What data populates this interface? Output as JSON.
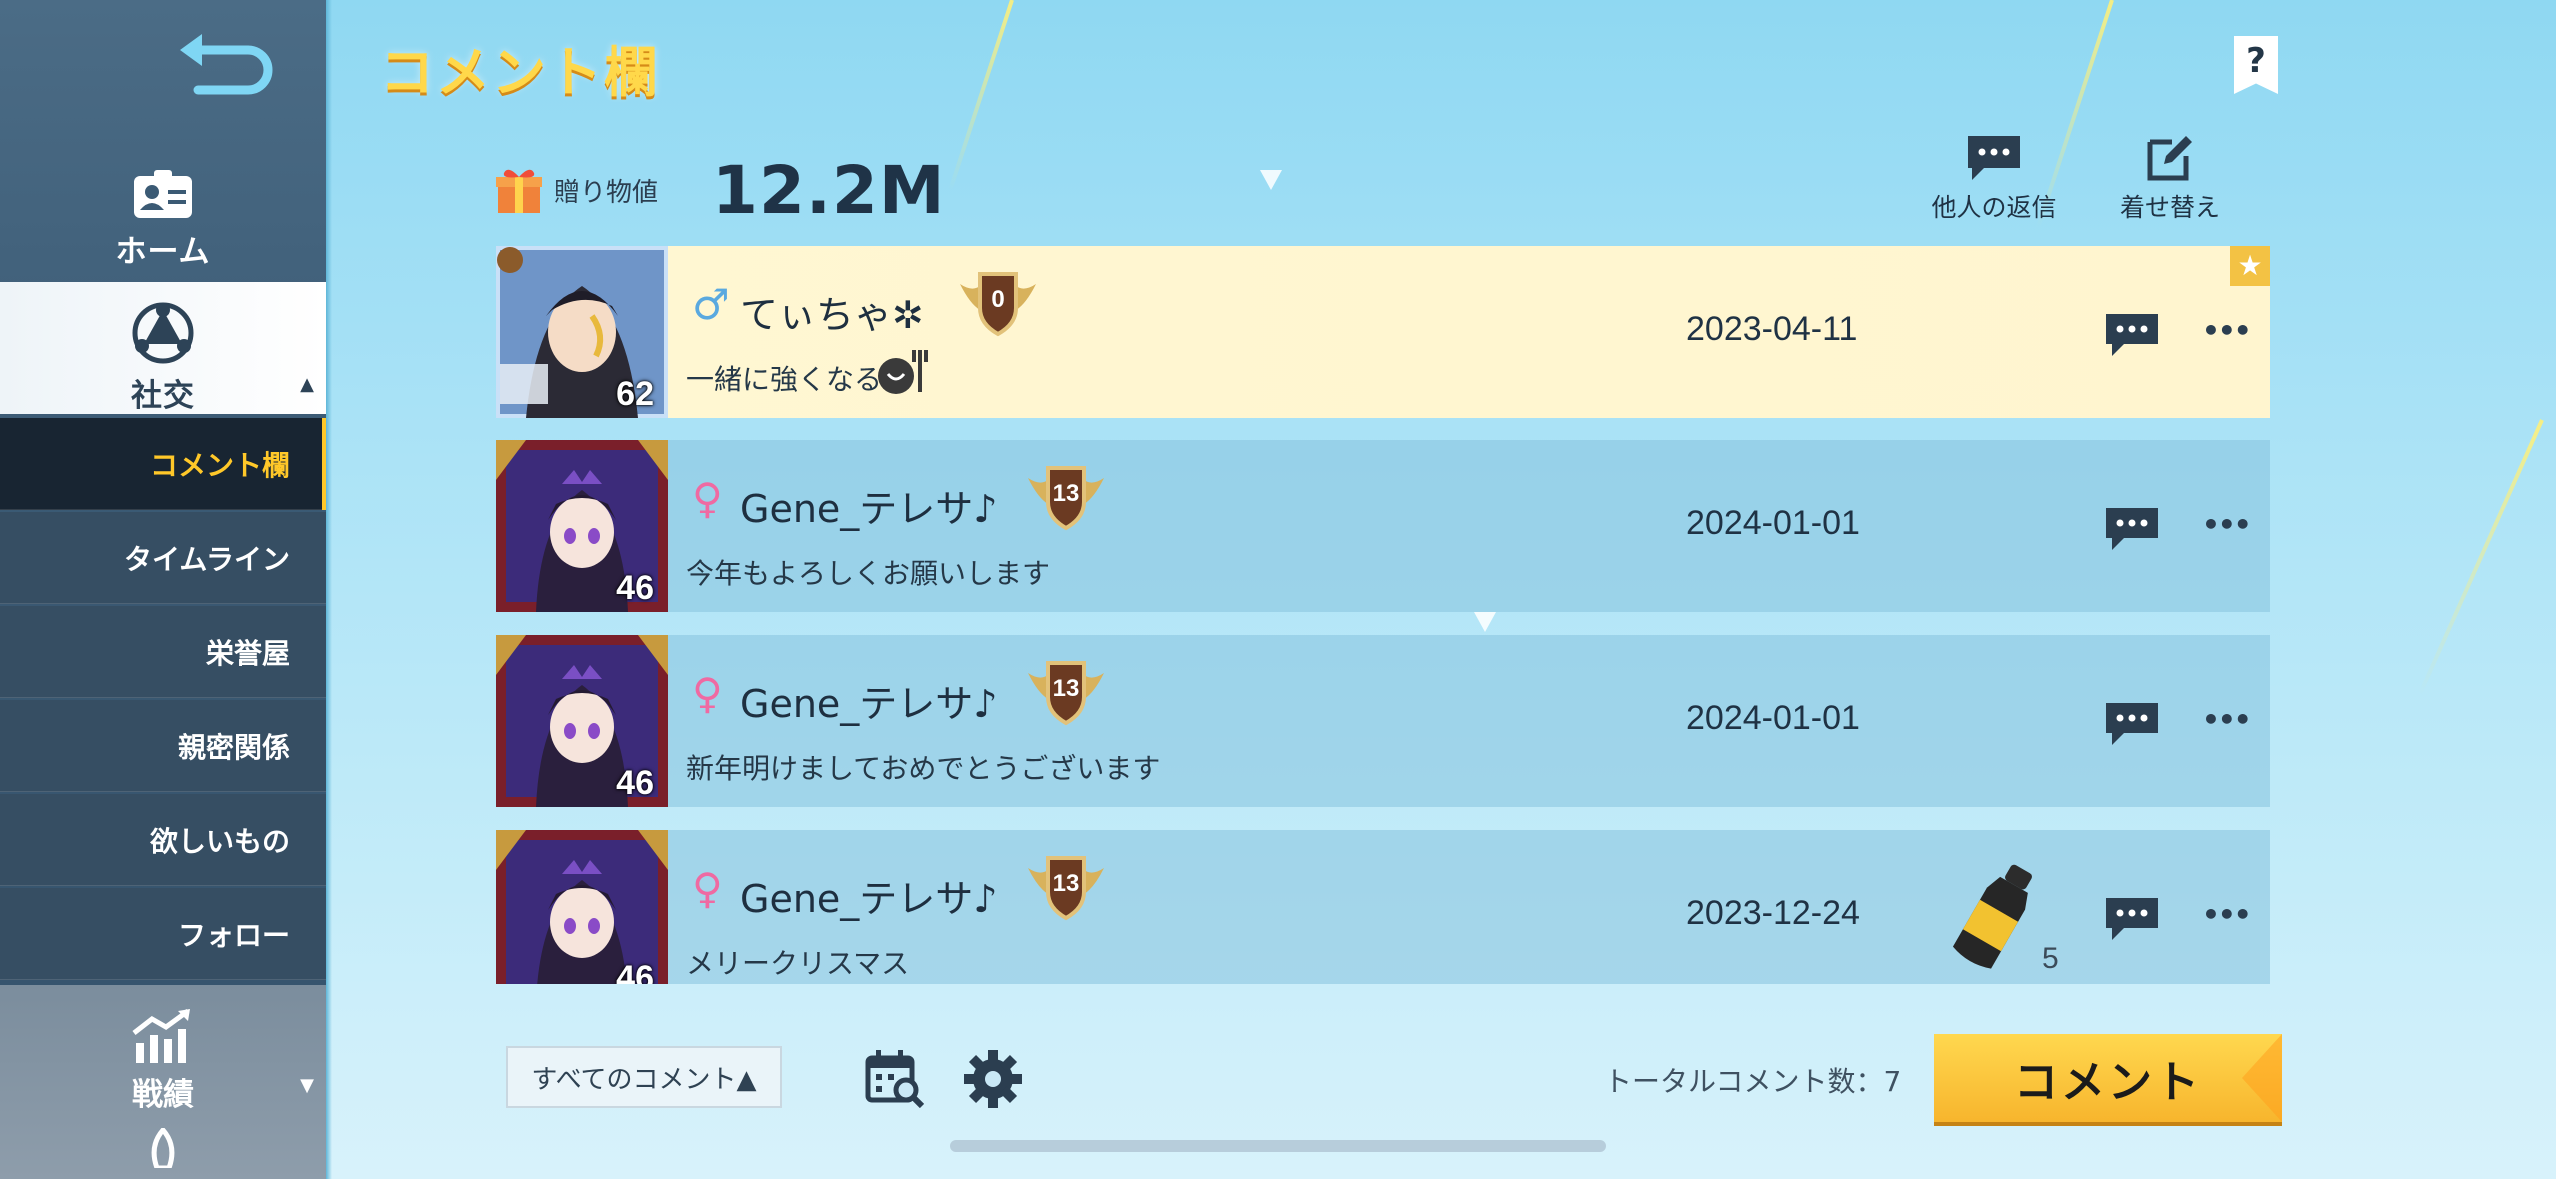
{
  "sidebar": {
    "home": "ホーム",
    "social": "社交",
    "sub_items": [
      "コメント欄",
      "タイムライン",
      "栄誉屋",
      "親密関係",
      "欲しいもの",
      "フォロー"
    ],
    "record": "戦績"
  },
  "header": {
    "title": "コメント欄",
    "help": "?",
    "gift_label": "贈り物値",
    "gift_value": "12.2M",
    "others_replies": "他人の返信",
    "dress_up": "着せ替え"
  },
  "comments": [
    {
      "gender": "♂",
      "name": "てぃちゃ✲",
      "rank": "0",
      "level": "62",
      "text": "一緒に強くなる",
      "date": "2023-04-11"
    },
    {
      "gender": "♀",
      "name": "Gene_テレサ♪",
      "rank": "13",
      "level": "46",
      "text": "今年もよろしくお願いします",
      "date": "2024-01-01"
    },
    {
      "gender": "♀",
      "name": "Gene_テレサ♪",
      "rank": "13",
      "level": "46",
      "text": "新年明けましておめでとうございます",
      "date": "2024-01-01"
    },
    {
      "gender": "♀",
      "name": "Gene_テレサ♪",
      "rank": "13",
      "level": "46",
      "text": "メリークリスマス",
      "date": "2023-12-24",
      "gift_count": "5"
    }
  ],
  "footer": {
    "filter": "すべてのコメント▲",
    "total": "トータルコメント数：7",
    "comment_button": "コメント"
  },
  "colors": {
    "accent_yellow": "#ffc829",
    "title_yellow": "#ffd84a",
    "sidebar": "#3b5a74",
    "active_sub": "#182532",
    "male": "#5aa9df",
    "female": "#ef6aa2"
  }
}
